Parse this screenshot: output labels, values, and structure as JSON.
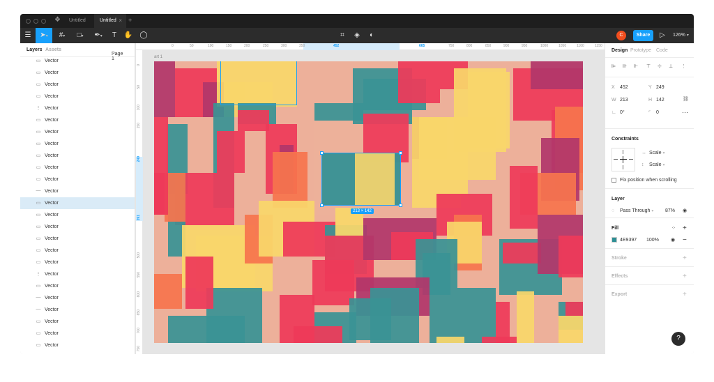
{
  "tabs": [
    {
      "label": "Untitled"
    },
    {
      "label": "Untitled",
      "close": "×"
    }
  ],
  "tab_add": "+",
  "toolbar": {
    "share_label": "Share",
    "avatar_letter": "C",
    "zoom": "126%",
    "play": "▷"
  },
  "left_panel": {
    "tab_layers": "Layers",
    "tab_assets": "Assets",
    "page": "Page 1",
    "layers": [
      {
        "name": "Vector",
        "icon": "rect"
      },
      {
        "name": "Vector",
        "icon": "rect"
      },
      {
        "name": "Vector",
        "icon": "rect"
      },
      {
        "name": "Vector",
        "icon": "rect"
      },
      {
        "name": "Vector",
        "icon": "line-v"
      },
      {
        "name": "Vector",
        "icon": "rect"
      },
      {
        "name": "Vector",
        "icon": "rect"
      },
      {
        "name": "Vector",
        "icon": "rect"
      },
      {
        "name": "Vector",
        "icon": "rect"
      },
      {
        "name": "Vector",
        "icon": "rect"
      },
      {
        "name": "Vector",
        "icon": "rect"
      },
      {
        "name": "Vector",
        "icon": "line-h"
      },
      {
        "name": "Vector",
        "icon": "rect",
        "selected": true
      },
      {
        "name": "Vector",
        "icon": "rect"
      },
      {
        "name": "Vector",
        "icon": "rect"
      },
      {
        "name": "Vector",
        "icon": "rect"
      },
      {
        "name": "Vector",
        "icon": "rect"
      },
      {
        "name": "Vector",
        "icon": "rect"
      },
      {
        "name": "Vector",
        "icon": "line-v"
      },
      {
        "name": "Vector",
        "icon": "rect"
      },
      {
        "name": "Vector",
        "icon": "line-h"
      },
      {
        "name": "Vector",
        "icon": "line-h"
      },
      {
        "name": "Vector",
        "icon": "rect"
      },
      {
        "name": "Vector",
        "icon": "rect"
      },
      {
        "name": "Vector",
        "icon": "rect"
      },
      {
        "name": "Vector",
        "icon": "rect"
      }
    ]
  },
  "rulers": {
    "top": [
      "0",
      "50",
      "100",
      "150",
      "200",
      "250",
      "300",
      "350",
      "452",
      "",
      "",
      "",
      "665",
      "750",
      "800",
      "850",
      "900",
      "950",
      "1000",
      "1050",
      "1100",
      "1150",
      "1200"
    ],
    "left": [
      "0",
      "50",
      "100",
      "150",
      "249",
      "",
      "391",
      "500",
      "550",
      "600",
      "650",
      "700",
      "750"
    ]
  },
  "canvas": {
    "frame_label": "art 1",
    "dimension_label": "213 × 142"
  },
  "right_panel": {
    "tabs": [
      "Design",
      "Prototype",
      "Code"
    ],
    "x": "452",
    "y": "249",
    "w": "213",
    "h": "142",
    "rotation": "0°",
    "radius": "0",
    "constraints_title": "Constraints",
    "constraint_h": "Scale",
    "constraint_v": "Scale",
    "fix_position": "Fix position when scrolling",
    "layer_title": "Layer",
    "blend_mode": "Pass Through",
    "layer_opacity": "87%",
    "fill_title": "Fill",
    "fill_hex": "4E9397",
    "fill_color": "#2e8f94",
    "fill_opacity": "100%",
    "stroke_title": "Stroke",
    "effects_title": "Effects",
    "export_title": "Export"
  },
  "help": "?",
  "colors": {
    "accent": "#18a0fb",
    "teal": "#3a9295",
    "yellow": "#f9d66b",
    "red": "#ee3a59",
    "magenta": "#b2376b",
    "coral": "#f6744d",
    "peach": "#edb09a"
  }
}
